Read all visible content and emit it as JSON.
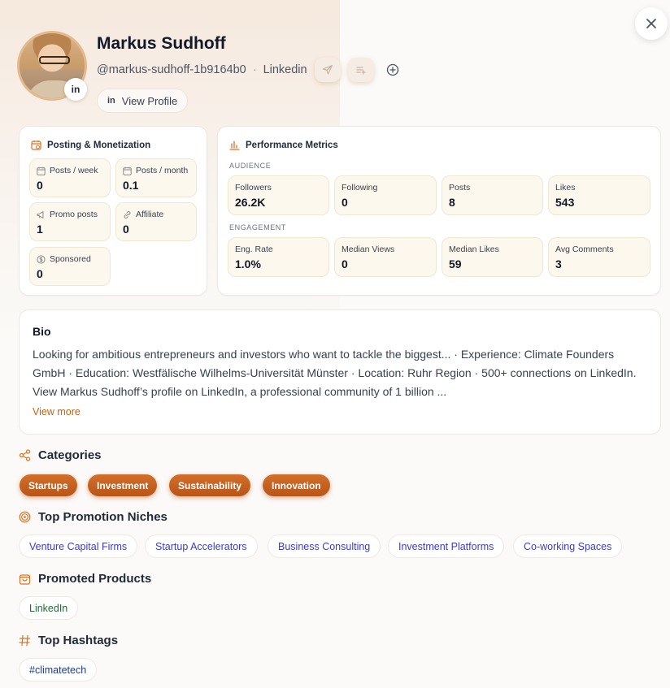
{
  "profile": {
    "name": "Markus Sudhoff",
    "handle": "@markus-sudhoff-1b9164b0",
    "separator": "·",
    "platform": "Linkedin",
    "avatar_badge": "in",
    "view_profile_icon": "in",
    "view_profile_label": "View Profile"
  },
  "posting": {
    "title": "Posting & Monetization",
    "metrics": [
      {
        "label": "Posts / week",
        "value": "0",
        "icon": "calendar-icon"
      },
      {
        "label": "Posts / month",
        "value": "0.1",
        "icon": "calendar-icon"
      },
      {
        "label": "Promo posts",
        "value": "1",
        "icon": "megaphone-icon"
      },
      {
        "label": "Affiliate",
        "value": "0",
        "icon": "link-icon"
      },
      {
        "label": "Sponsored",
        "value": "0",
        "icon": "dollar-icon"
      }
    ]
  },
  "performance": {
    "title": "Performance Metrics",
    "audience_label": "AUDIENCE",
    "engagement_label": "ENGAGEMENT",
    "audience": [
      {
        "label": "Followers",
        "value": "26.2K"
      },
      {
        "label": "Following",
        "value": "0"
      },
      {
        "label": "Posts",
        "value": "8"
      },
      {
        "label": "Likes",
        "value": "543"
      }
    ],
    "engagement": [
      {
        "label": "Eng. Rate",
        "value": "1.0%"
      },
      {
        "label": "Median Views",
        "value": "0"
      },
      {
        "label": "Median Likes",
        "value": "59"
      },
      {
        "label": "Avg Comments",
        "value": "3"
      }
    ]
  },
  "bio": {
    "title": "Bio",
    "text": "Looking for ambitious entrepreneurs and investors who want to tackle the biggest... · Experience: Climate Founders GmbH · Education: Westfälische Wilhelms-Universität Münster · Location: Ruhr Region · 500+ connections on LinkedIn. View Markus Sudhoff’s profile on LinkedIn, a professional community of 1 billion ...",
    "more": "View more"
  },
  "categories": {
    "title": "Categories",
    "items": [
      "Startups",
      "Investment",
      "Sustainability",
      "Innovation"
    ]
  },
  "niches": {
    "title": "Top Promotion Niches",
    "items": [
      "Venture Capital Firms",
      "Startup Accelerators",
      "Business Consulting",
      "Investment Platforms",
      "Co-working Spaces"
    ]
  },
  "products": {
    "title": "Promoted Products",
    "items": [
      "LinkedIn"
    ]
  },
  "hashtags": {
    "title": "Top Hashtags",
    "items": [
      "#climatetech"
    ]
  },
  "colors": {
    "accent": "#c2620f",
    "category_chip": "#c45f1f",
    "metric_bg": "#fdf8ee",
    "niche_text": "#3b3bd1"
  }
}
